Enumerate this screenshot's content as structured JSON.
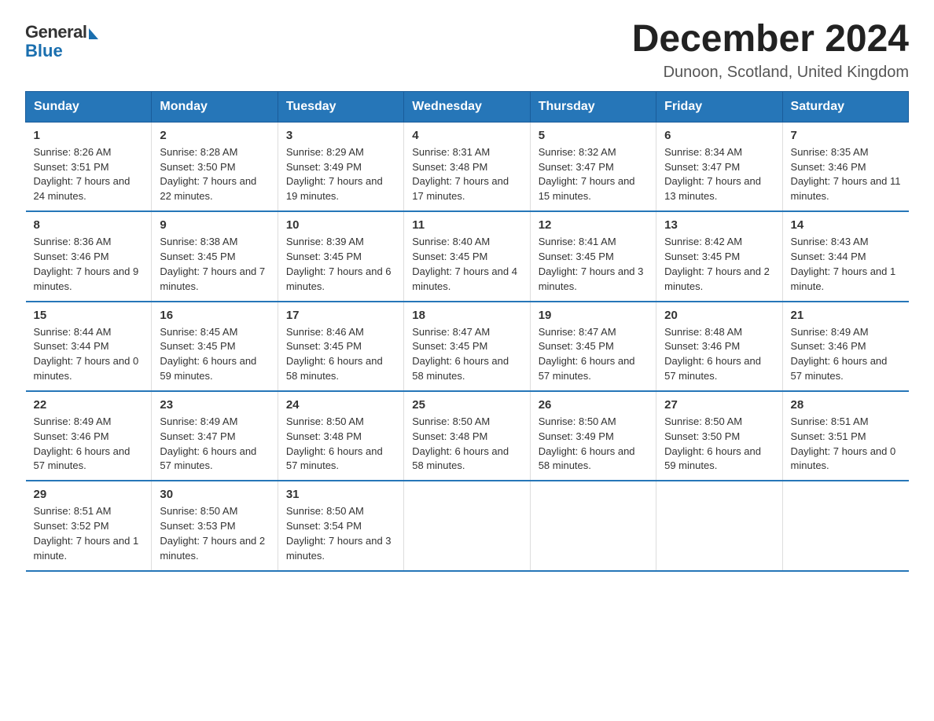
{
  "logo": {
    "general": "General",
    "blue": "Blue"
  },
  "title": "December 2024",
  "location": "Dunoon, Scotland, United Kingdom",
  "days_of_week": [
    "Sunday",
    "Monday",
    "Tuesday",
    "Wednesday",
    "Thursday",
    "Friday",
    "Saturday"
  ],
  "weeks": [
    [
      {
        "day": "1",
        "sunrise": "Sunrise: 8:26 AM",
        "sunset": "Sunset: 3:51 PM",
        "daylight": "Daylight: 7 hours and 24 minutes."
      },
      {
        "day": "2",
        "sunrise": "Sunrise: 8:28 AM",
        "sunset": "Sunset: 3:50 PM",
        "daylight": "Daylight: 7 hours and 22 minutes."
      },
      {
        "day": "3",
        "sunrise": "Sunrise: 8:29 AM",
        "sunset": "Sunset: 3:49 PM",
        "daylight": "Daylight: 7 hours and 19 minutes."
      },
      {
        "day": "4",
        "sunrise": "Sunrise: 8:31 AM",
        "sunset": "Sunset: 3:48 PM",
        "daylight": "Daylight: 7 hours and 17 minutes."
      },
      {
        "day": "5",
        "sunrise": "Sunrise: 8:32 AM",
        "sunset": "Sunset: 3:47 PM",
        "daylight": "Daylight: 7 hours and 15 minutes."
      },
      {
        "day": "6",
        "sunrise": "Sunrise: 8:34 AM",
        "sunset": "Sunset: 3:47 PM",
        "daylight": "Daylight: 7 hours and 13 minutes."
      },
      {
        "day": "7",
        "sunrise": "Sunrise: 8:35 AM",
        "sunset": "Sunset: 3:46 PM",
        "daylight": "Daylight: 7 hours and 11 minutes."
      }
    ],
    [
      {
        "day": "8",
        "sunrise": "Sunrise: 8:36 AM",
        "sunset": "Sunset: 3:46 PM",
        "daylight": "Daylight: 7 hours and 9 minutes."
      },
      {
        "day": "9",
        "sunrise": "Sunrise: 8:38 AM",
        "sunset": "Sunset: 3:45 PM",
        "daylight": "Daylight: 7 hours and 7 minutes."
      },
      {
        "day": "10",
        "sunrise": "Sunrise: 8:39 AM",
        "sunset": "Sunset: 3:45 PM",
        "daylight": "Daylight: 7 hours and 6 minutes."
      },
      {
        "day": "11",
        "sunrise": "Sunrise: 8:40 AM",
        "sunset": "Sunset: 3:45 PM",
        "daylight": "Daylight: 7 hours and 4 minutes."
      },
      {
        "day": "12",
        "sunrise": "Sunrise: 8:41 AM",
        "sunset": "Sunset: 3:45 PM",
        "daylight": "Daylight: 7 hours and 3 minutes."
      },
      {
        "day": "13",
        "sunrise": "Sunrise: 8:42 AM",
        "sunset": "Sunset: 3:45 PM",
        "daylight": "Daylight: 7 hours and 2 minutes."
      },
      {
        "day": "14",
        "sunrise": "Sunrise: 8:43 AM",
        "sunset": "Sunset: 3:44 PM",
        "daylight": "Daylight: 7 hours and 1 minute."
      }
    ],
    [
      {
        "day": "15",
        "sunrise": "Sunrise: 8:44 AM",
        "sunset": "Sunset: 3:44 PM",
        "daylight": "Daylight: 7 hours and 0 minutes."
      },
      {
        "day": "16",
        "sunrise": "Sunrise: 8:45 AM",
        "sunset": "Sunset: 3:45 PM",
        "daylight": "Daylight: 6 hours and 59 minutes."
      },
      {
        "day": "17",
        "sunrise": "Sunrise: 8:46 AM",
        "sunset": "Sunset: 3:45 PM",
        "daylight": "Daylight: 6 hours and 58 minutes."
      },
      {
        "day": "18",
        "sunrise": "Sunrise: 8:47 AM",
        "sunset": "Sunset: 3:45 PM",
        "daylight": "Daylight: 6 hours and 58 minutes."
      },
      {
        "day": "19",
        "sunrise": "Sunrise: 8:47 AM",
        "sunset": "Sunset: 3:45 PM",
        "daylight": "Daylight: 6 hours and 57 minutes."
      },
      {
        "day": "20",
        "sunrise": "Sunrise: 8:48 AM",
        "sunset": "Sunset: 3:46 PM",
        "daylight": "Daylight: 6 hours and 57 minutes."
      },
      {
        "day": "21",
        "sunrise": "Sunrise: 8:49 AM",
        "sunset": "Sunset: 3:46 PM",
        "daylight": "Daylight: 6 hours and 57 minutes."
      }
    ],
    [
      {
        "day": "22",
        "sunrise": "Sunrise: 8:49 AM",
        "sunset": "Sunset: 3:46 PM",
        "daylight": "Daylight: 6 hours and 57 minutes."
      },
      {
        "day": "23",
        "sunrise": "Sunrise: 8:49 AM",
        "sunset": "Sunset: 3:47 PM",
        "daylight": "Daylight: 6 hours and 57 minutes."
      },
      {
        "day": "24",
        "sunrise": "Sunrise: 8:50 AM",
        "sunset": "Sunset: 3:48 PM",
        "daylight": "Daylight: 6 hours and 57 minutes."
      },
      {
        "day": "25",
        "sunrise": "Sunrise: 8:50 AM",
        "sunset": "Sunset: 3:48 PM",
        "daylight": "Daylight: 6 hours and 58 minutes."
      },
      {
        "day": "26",
        "sunrise": "Sunrise: 8:50 AM",
        "sunset": "Sunset: 3:49 PM",
        "daylight": "Daylight: 6 hours and 58 minutes."
      },
      {
        "day": "27",
        "sunrise": "Sunrise: 8:50 AM",
        "sunset": "Sunset: 3:50 PM",
        "daylight": "Daylight: 6 hours and 59 minutes."
      },
      {
        "day": "28",
        "sunrise": "Sunrise: 8:51 AM",
        "sunset": "Sunset: 3:51 PM",
        "daylight": "Daylight: 7 hours and 0 minutes."
      }
    ],
    [
      {
        "day": "29",
        "sunrise": "Sunrise: 8:51 AM",
        "sunset": "Sunset: 3:52 PM",
        "daylight": "Daylight: 7 hours and 1 minute."
      },
      {
        "day": "30",
        "sunrise": "Sunrise: 8:50 AM",
        "sunset": "Sunset: 3:53 PM",
        "daylight": "Daylight: 7 hours and 2 minutes."
      },
      {
        "day": "31",
        "sunrise": "Sunrise: 8:50 AM",
        "sunset": "Sunset: 3:54 PM",
        "daylight": "Daylight: 7 hours and 3 minutes."
      },
      {
        "day": "",
        "sunrise": "",
        "sunset": "",
        "daylight": ""
      },
      {
        "day": "",
        "sunrise": "",
        "sunset": "",
        "daylight": ""
      },
      {
        "day": "",
        "sunrise": "",
        "sunset": "",
        "daylight": ""
      },
      {
        "day": "",
        "sunrise": "",
        "sunset": "",
        "daylight": ""
      }
    ]
  ]
}
